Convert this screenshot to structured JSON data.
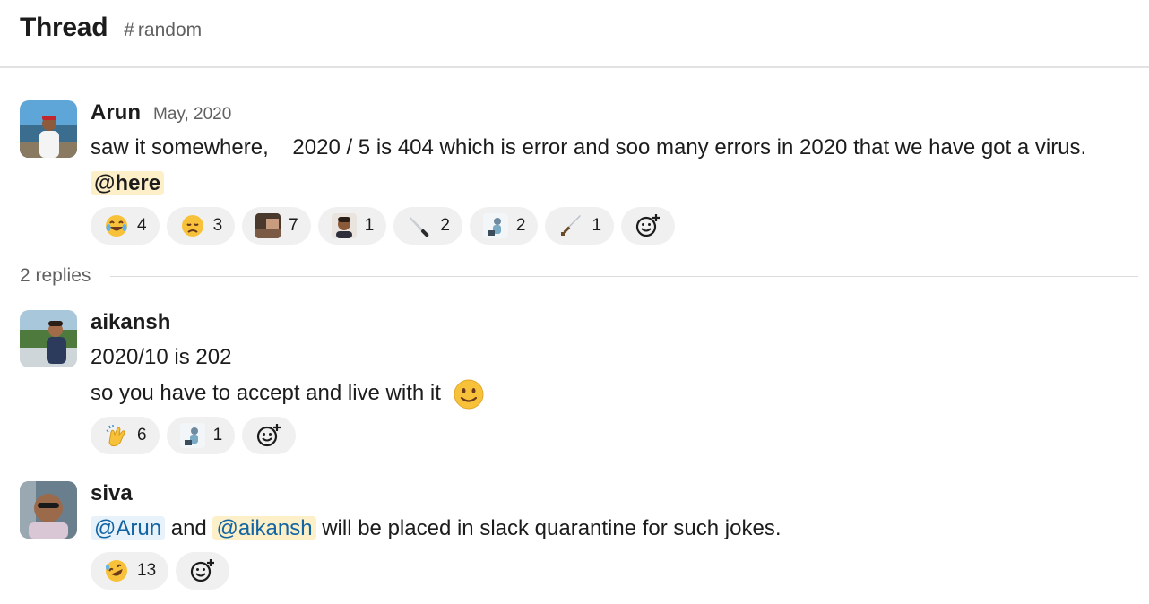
{
  "header": {
    "title": "Thread",
    "hash": "#",
    "channel": "random"
  },
  "parent": {
    "author": "Arun",
    "date": "May, 2020",
    "text_part1": "saw it somewhere,    2020 / 5 is 404 which is error and soo many errors in 2020 that we have got a virus. ",
    "mention": "@here",
    "reactions": [
      {
        "icon": "joy-emoji",
        "count": "4"
      },
      {
        "icon": "disappointed-emoji",
        "count": "3"
      },
      {
        "icon": "custom-photo-emoji",
        "count": "7"
      },
      {
        "icon": "custom-face-emoji",
        "count": "1"
      },
      {
        "icon": "knife-emoji",
        "count": "2"
      },
      {
        "icon": "custom-figure-emoji",
        "count": "2"
      },
      {
        "icon": "dagger-emoji",
        "count": "1"
      }
    ]
  },
  "replies_label": "2 replies",
  "reply1": {
    "author": "aikansh",
    "line1": "2020/10 is 202",
    "line2": "so you have to accept and live with it",
    "reactions": [
      {
        "icon": "clap-emoji",
        "count": "6"
      },
      {
        "icon": "custom-figure-emoji",
        "count": "1"
      }
    ]
  },
  "reply2": {
    "author": "siva",
    "mention1": "@Arun",
    "and_text": " and ",
    "mention2": "@aikansh",
    "rest": " will be placed in slack quarantine for such jokes.",
    "reactions": [
      {
        "icon": "rofl-emoji",
        "count": "13"
      }
    ]
  },
  "colors": {
    "mention_blue": "#1264a3",
    "mention_bg_yellow": "#fdf0c8",
    "reaction_bg": "#f0f0f0"
  }
}
